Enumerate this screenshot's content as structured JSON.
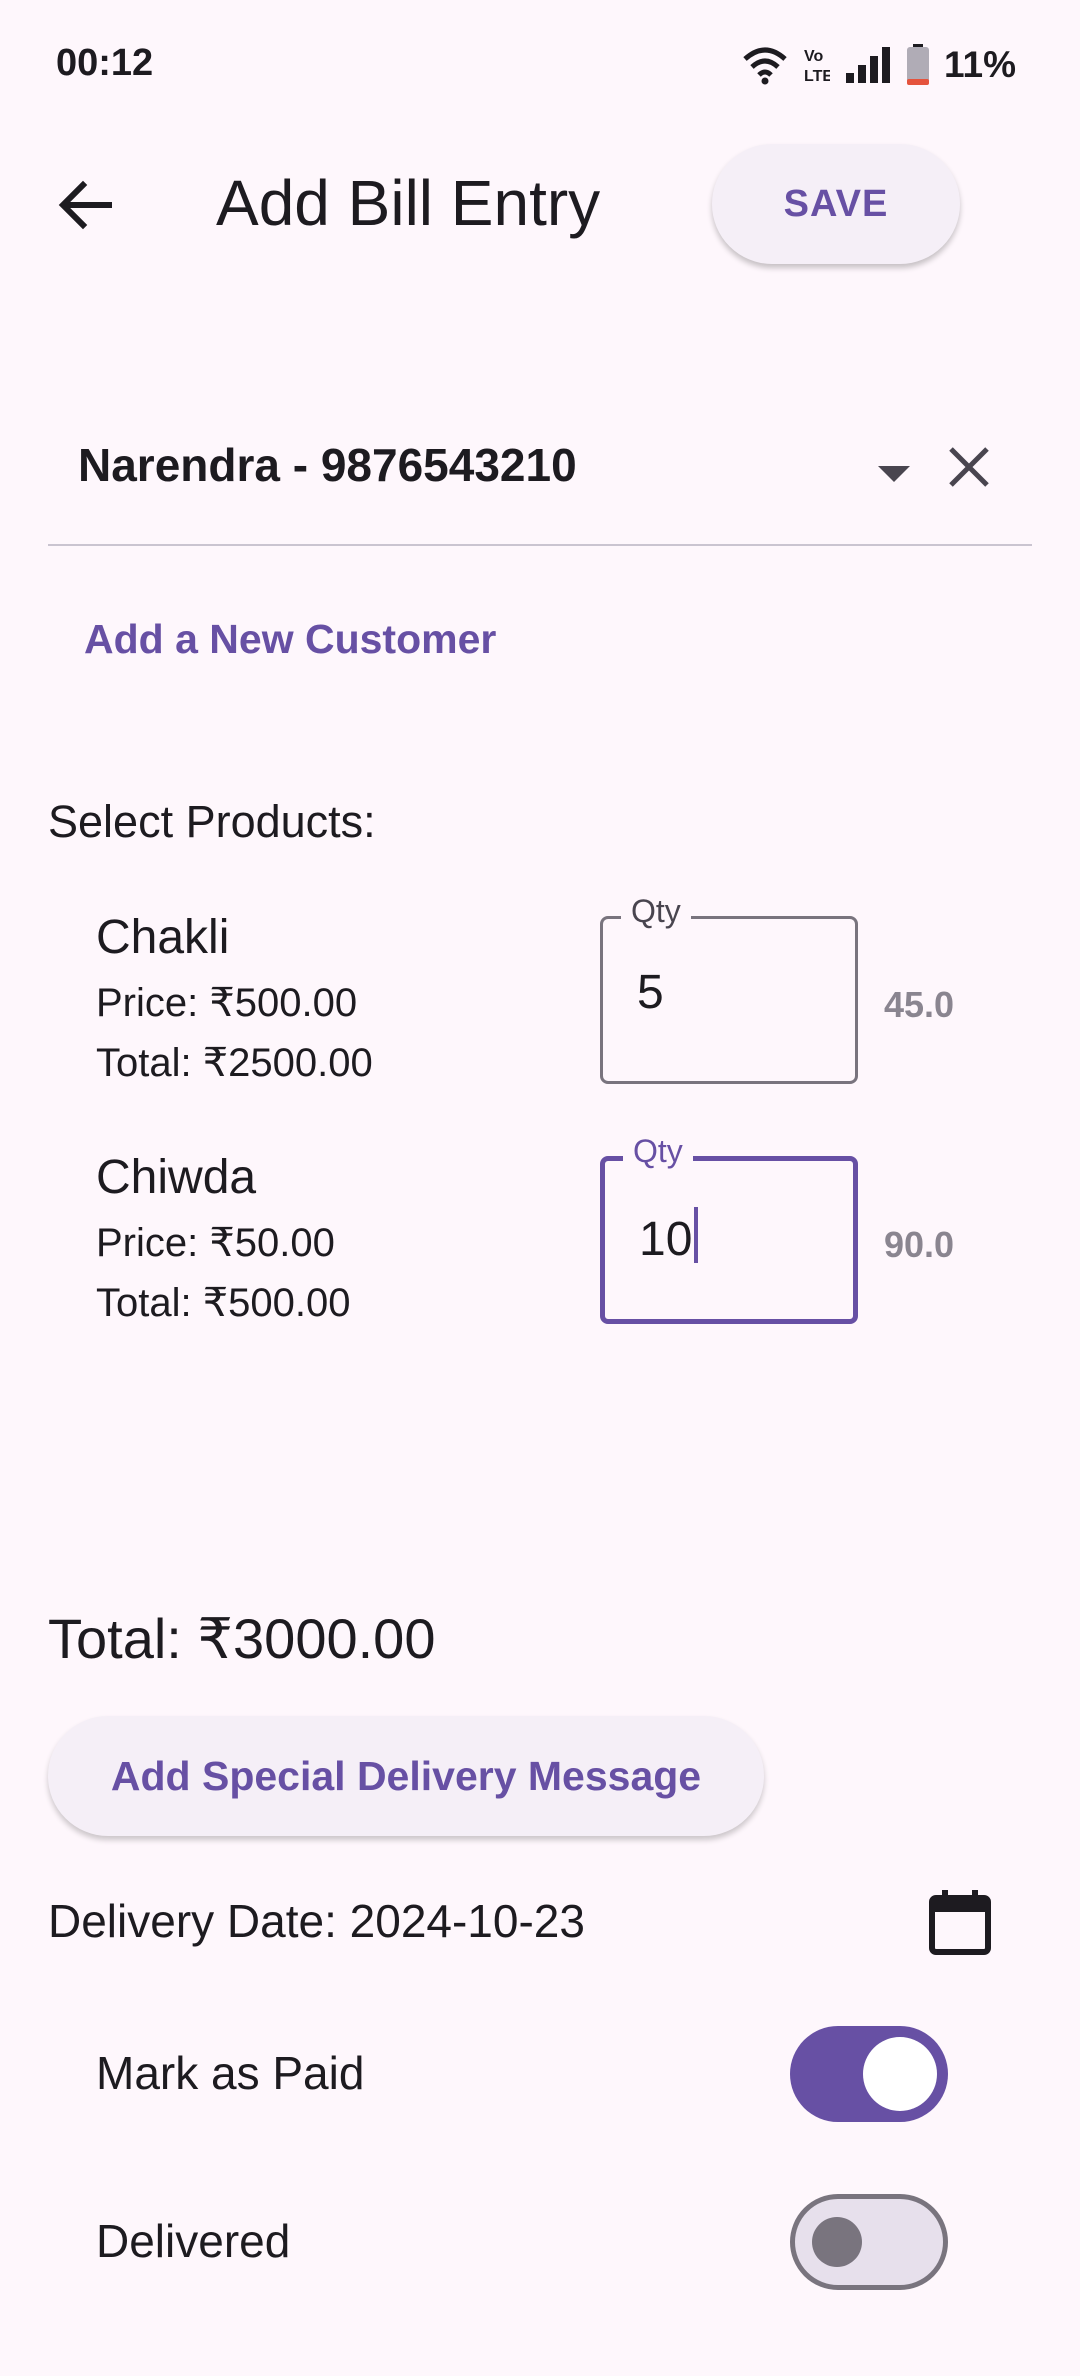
{
  "status_bar": {
    "time": "00:12",
    "volte_label": "Vo\nLTE",
    "battery_percent": "11%",
    "icons": [
      "wifi-icon",
      "volte-icon",
      "signal-icon",
      "battery-icon"
    ]
  },
  "app_bar": {
    "title": "Add Bill Entry",
    "save_label": "SAVE",
    "back_icon": "arrow-back-icon"
  },
  "customer": {
    "selected": "Narendra - 9876543210",
    "add_new_label": "Add a New Customer"
  },
  "products_section": {
    "label": "Select Products:",
    "items": [
      {
        "name": "Chakli",
        "price": "Price: ₹500.00",
        "total": "Total: ₹2500.00",
        "qty_label": "Qty",
        "qty_value": "5",
        "amount": "45.0",
        "focused": false
      },
      {
        "name": "Chiwda",
        "price": "Price: ₹50.00",
        "total": "Total: ₹500.00",
        "qty_label": "Qty",
        "qty_value": "10",
        "amount": "90.0",
        "focused": true
      }
    ]
  },
  "grand_total": "Total: ₹3000.00",
  "special_message_label": "Add Special Delivery Message",
  "delivery_date": "Delivery Date: 2024-10-23",
  "toggles": {
    "paid": {
      "label": "Mark as Paid",
      "on": true
    },
    "delivered": {
      "label": "Delivered",
      "on": false
    }
  },
  "colors": {
    "accent": "#6750a4",
    "background": "#fef7fc",
    "text": "#1d1b20"
  }
}
